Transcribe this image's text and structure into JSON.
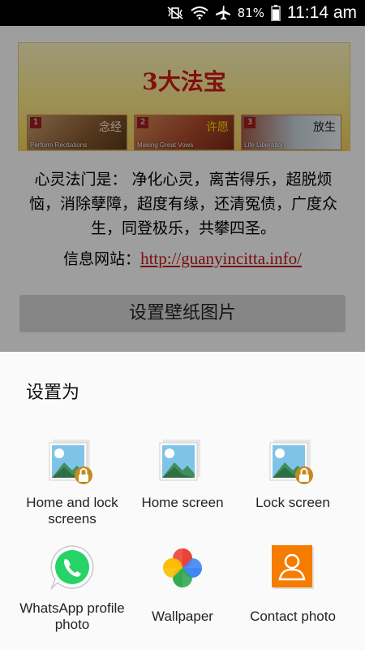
{
  "status_bar": {
    "battery": "81%",
    "time": "11:14 am",
    "icons": [
      "mute-vibrate-icon",
      "wifi-icon",
      "airplane-icon",
      "battery-icon"
    ]
  },
  "banner": {
    "title": "3大法宝",
    "tiles": [
      {
        "num": "1",
        "caption": "Perform Recitations",
        "deco": "念经"
      },
      {
        "num": "2",
        "caption": "Making Great Vows",
        "deco": "许愿"
      },
      {
        "num": "3",
        "caption": "Life Liberation",
        "deco": "放生"
      }
    ]
  },
  "description": "心灵法门是： 净化心灵，离苦得乐，超脱烦恼，消除孽障，超度有缘，还清冤债，广度众生，同登极乐，共攀四圣。",
  "website": {
    "label": "信息网站：",
    "url": "http://guanyincitta.info/"
  },
  "set_wallpaper_button": "设置壁纸图片",
  "sheet": {
    "title": "设置为",
    "options": [
      {
        "label": "Home and lock screens",
        "icon": "home-lock-gallery-icon"
      },
      {
        "label": "Home screen",
        "icon": "home-gallery-icon"
      },
      {
        "label": "Lock screen",
        "icon": "lock-gallery-icon"
      },
      {
        "label": "WhatsApp profile photo",
        "icon": "whatsapp-icon"
      },
      {
        "label": "Wallpaper",
        "icon": "google-photos-icon"
      },
      {
        "label": "Contact photo",
        "icon": "contact-icon"
      }
    ]
  },
  "colors": {
    "accent_red": "#c21515",
    "whatsapp_green": "#25d366",
    "contact_orange": "#f57c00"
  }
}
